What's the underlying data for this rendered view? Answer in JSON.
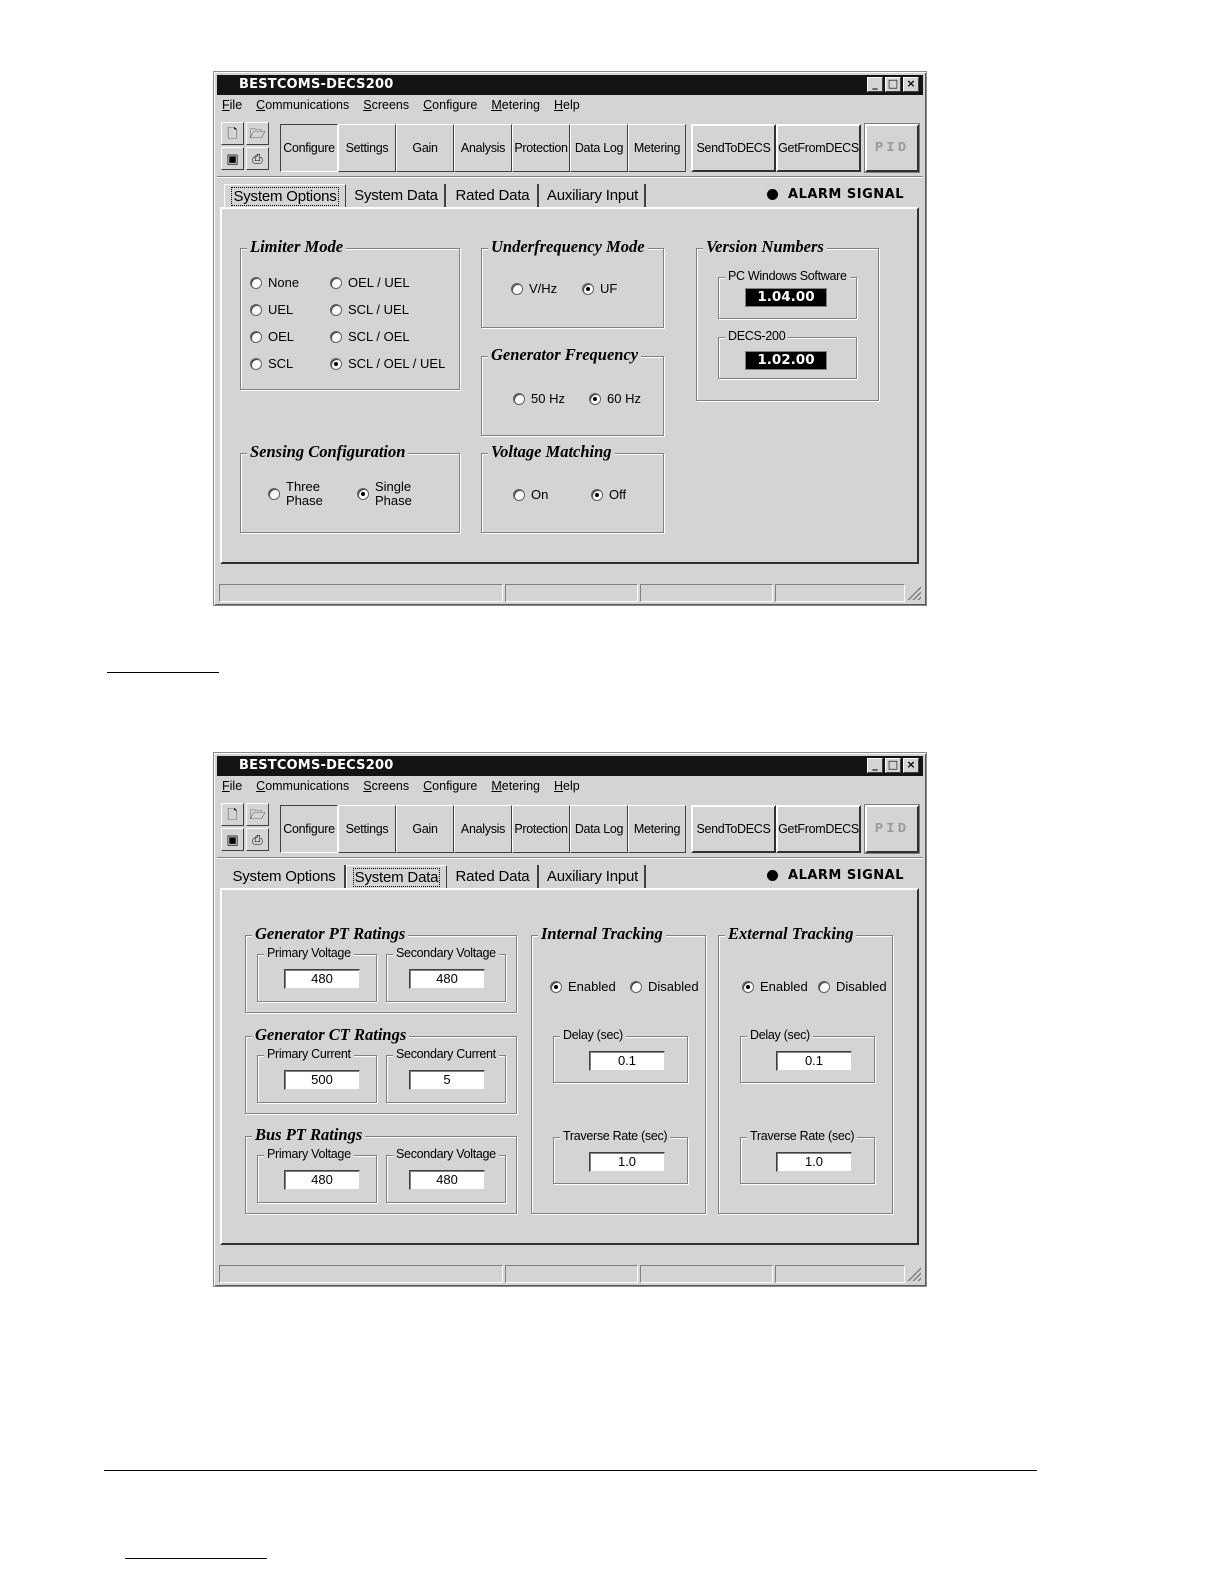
{
  "app": {
    "title": "BESTCOMS-DECS200",
    "window_buttons": [
      "_",
      "□",
      "×"
    ],
    "menu": [
      "File",
      "Communications",
      "Screens",
      "Configure",
      "Metering",
      "Help"
    ],
    "toolbar_icons": [
      "new-file-icon",
      "open-folder-icon",
      "save-icon",
      "print-icon"
    ],
    "nav_buttons": [
      "Configure",
      "Settings",
      "Gain",
      "Analysis",
      "Protection",
      "Data Log",
      "Metering"
    ],
    "send_button": "SendToDECS",
    "get_button": "GetFromDECS",
    "pid_button": "PID",
    "tabs": [
      "System Options",
      "System Data",
      "Rated Data",
      "Auxiliary Input"
    ],
    "alarm": "ALARM SIGNAL"
  },
  "screen1": {
    "active_tab": "System Options",
    "limiter_mode": {
      "title": "Limiter Mode",
      "options": [
        "None",
        "OEL / UEL",
        "UEL",
        "SCL / UEL",
        "OEL",
        "SCL / OEL",
        "SCL",
        "SCL / OEL / UEL"
      ],
      "selected": "SCL / OEL / UEL"
    },
    "underfrequency": {
      "title": "Underfrequency Mode",
      "options": [
        "V/Hz",
        "UF"
      ],
      "selected": "UF"
    },
    "gen_frequency": {
      "title": "Generator Frequency",
      "options": [
        "50 Hz",
        "60 Hz"
      ],
      "selected": "60 Hz"
    },
    "version": {
      "title": "Version Numbers",
      "pc_label": "PC Windows Software",
      "pc_value": "1.04.00",
      "decs_label": "DECS-200",
      "decs_value": "1.02.00"
    },
    "sensing": {
      "title": "Sensing Configuration",
      "opt1_line1": "Three",
      "opt1_line2": "Phase",
      "opt2_line1": "Single",
      "opt2_line2": "Phase",
      "selected": "Single Phase"
    },
    "voltage_matching": {
      "title": "Voltage Matching",
      "options": [
        "On",
        "Off"
      ],
      "selected": "Off"
    }
  },
  "screen2": {
    "active_tab": "System Data",
    "gen_pt": {
      "title": "Generator PT Ratings",
      "primary_label": "Primary Voltage",
      "primary": "480",
      "secondary_label": "Secondary Voltage",
      "secondary": "480"
    },
    "gen_ct": {
      "title": "Generator CT Ratings",
      "primary_label": "Primary Current",
      "primary": "500",
      "secondary_label": "Secondary Current",
      "secondary": "5"
    },
    "bus_pt": {
      "title": "Bus PT Ratings",
      "primary_label": "Primary Voltage",
      "primary": "480",
      "secondary_label": "Secondary Voltage",
      "secondary": "480"
    },
    "internal": {
      "title": "Internal Tracking",
      "enabled": "Enabled",
      "disabled": "Disabled",
      "selected": "Enabled",
      "delay_label": "Delay (sec)",
      "delay": "0.1",
      "traverse_label": "Traverse Rate (sec)",
      "traverse": "1.0"
    },
    "external": {
      "title": "External Tracking",
      "enabled": "Enabled",
      "disabled": "Disabled",
      "selected": "Enabled",
      "delay_label": "Delay (sec)",
      "delay": "0.1",
      "traverse_label": "Traverse Rate (sec)",
      "traverse": "1.0"
    }
  }
}
